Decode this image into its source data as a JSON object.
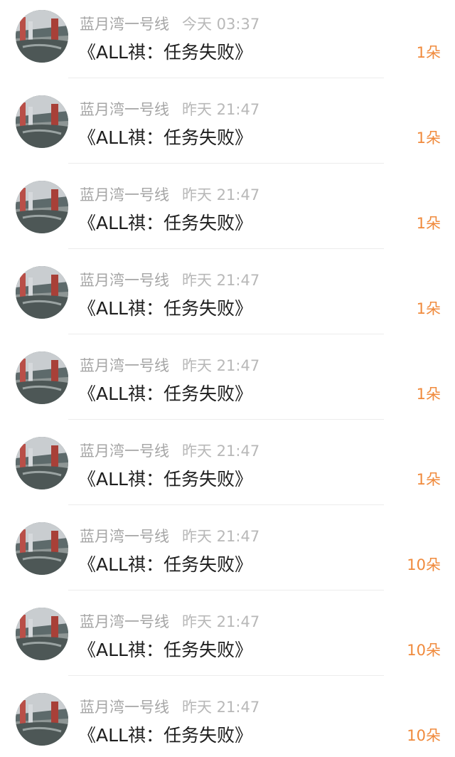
{
  "messages": [
    {
      "sender": "蓝月湾一号线",
      "time": "今天 03:37",
      "title": "《ALL祺：任务失败》",
      "count": "1朵"
    },
    {
      "sender": "蓝月湾一号线",
      "time": "昨天 21:47",
      "title": "《ALL祺：任务失败》",
      "count": "1朵"
    },
    {
      "sender": "蓝月湾一号线",
      "time": "昨天 21:47",
      "title": "《ALL祺：任务失败》",
      "count": "1朵"
    },
    {
      "sender": "蓝月湾一号线",
      "time": "昨天 21:47",
      "title": "《ALL祺：任务失败》",
      "count": "1朵"
    },
    {
      "sender": "蓝月湾一号线",
      "time": "昨天 21:47",
      "title": "《ALL祺：任务失败》",
      "count": "1朵"
    },
    {
      "sender": "蓝月湾一号线",
      "time": "昨天 21:47",
      "title": "《ALL祺：任务失败》",
      "count": "1朵"
    },
    {
      "sender": "蓝月湾一号线",
      "time": "昨天 21:47",
      "title": "《ALL祺：任务失败》",
      "count": "10朵"
    },
    {
      "sender": "蓝月湾一号线",
      "time": "昨天 21:47",
      "title": "《ALL祺：任务失败》",
      "count": "10朵"
    },
    {
      "sender": "蓝月湾一号线",
      "time": "昨天 21:47",
      "title": "《ALL祺：任务失败》",
      "count": "10朵"
    }
  ],
  "colors": {
    "count_accent": "#f08a3c",
    "meta_text": "#a6a6a6",
    "title_text": "#1e1e1e"
  }
}
